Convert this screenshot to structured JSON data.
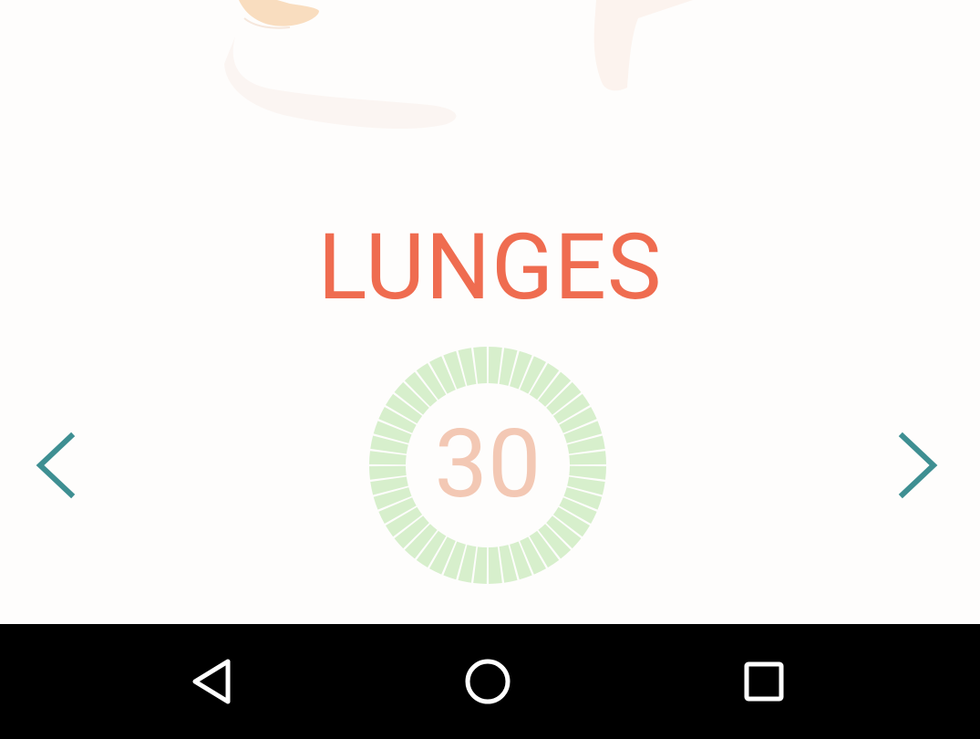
{
  "exercise": {
    "name": "LUNGES"
  },
  "timer": {
    "seconds_remaining": "30",
    "ring_segments": 48
  },
  "navigation": {
    "prev_icon": "chevron-left-icon",
    "next_icon": "chevron-right-icon"
  },
  "system_nav": {
    "back_icon": "back-triangle-icon",
    "home_icon": "home-circle-icon",
    "recents_icon": "recents-square-icon"
  },
  "colors": {
    "title": "#ef6c50",
    "count": "#f3c8b4",
    "ring": "#d7efcc",
    "arrow": "#3e8f92",
    "nav_bar": "#000000"
  }
}
